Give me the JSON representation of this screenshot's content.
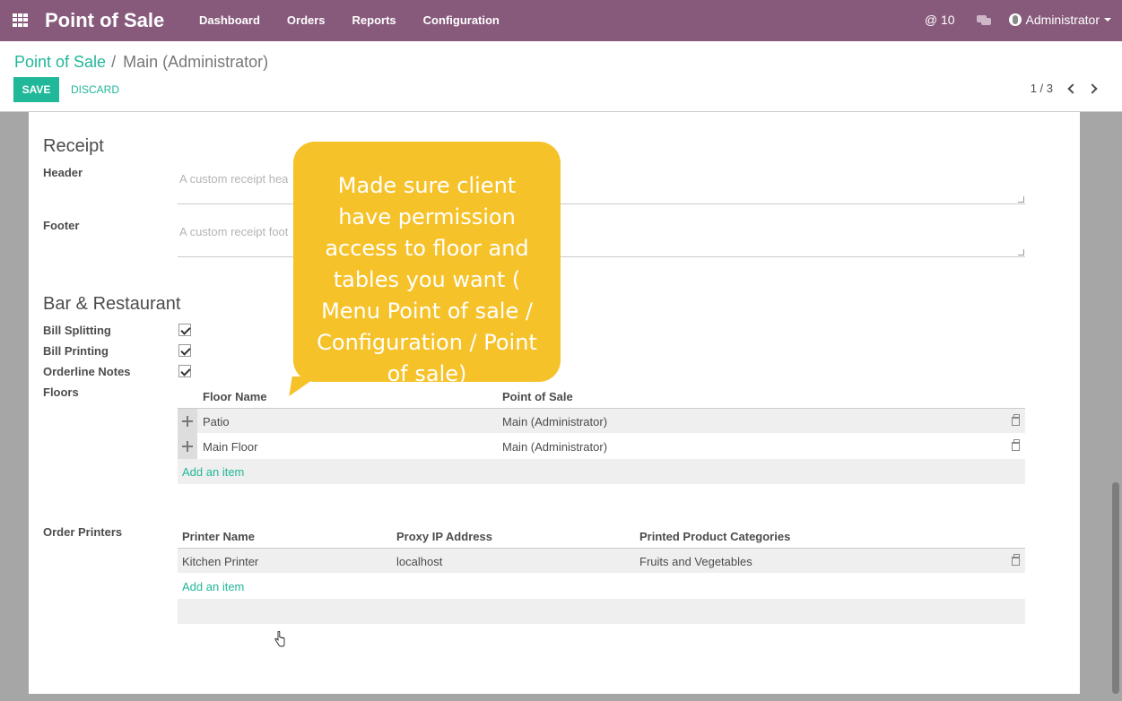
{
  "navbar": {
    "brand": "Point of Sale",
    "menu": [
      "Dashboard",
      "Orders",
      "Reports",
      "Configuration"
    ],
    "mentions": "@ 10",
    "user": "Administrator"
  },
  "control": {
    "breadcrumb_root": "Point of Sale",
    "breadcrumb_sep": "/",
    "breadcrumb_current": "Main (Administrator)",
    "save_label": "SAVE",
    "discard_label": "DISCARD",
    "pager": "1 / 3"
  },
  "receipt": {
    "title": "Receipt",
    "header_label": "Header",
    "header_placeholder": "A custom receipt hea",
    "footer_label": "Footer",
    "footer_placeholder": "A custom receipt foot"
  },
  "restaurant": {
    "title": "Bar & Restaurant",
    "bill_splitting_label": "Bill Splitting",
    "bill_printing_label": "Bill Printing",
    "orderline_notes_label": "Orderline Notes",
    "floors_label": "Floors",
    "floors_table": {
      "columns": [
        "Floor Name",
        "Point of Sale"
      ],
      "rows": [
        [
          "Patio",
          "Main (Administrator)"
        ],
        [
          "Main Floor",
          "Main (Administrator)"
        ]
      ],
      "add_label": "Add an item"
    }
  },
  "printers": {
    "label": "Order Printers",
    "table": {
      "columns": [
        "Printer Name",
        "Proxy IP Address",
        "Printed Product Categories"
      ],
      "rows": [
        [
          "Kitchen Printer",
          "localhost",
          "Fruits and Vegetables"
        ]
      ],
      "add_label": "Add an item"
    }
  },
  "tooltip": {
    "text": "Made sure client have permission access to floor and tables you want ( Menu Point of sale / Configuration / Point of sale)"
  }
}
